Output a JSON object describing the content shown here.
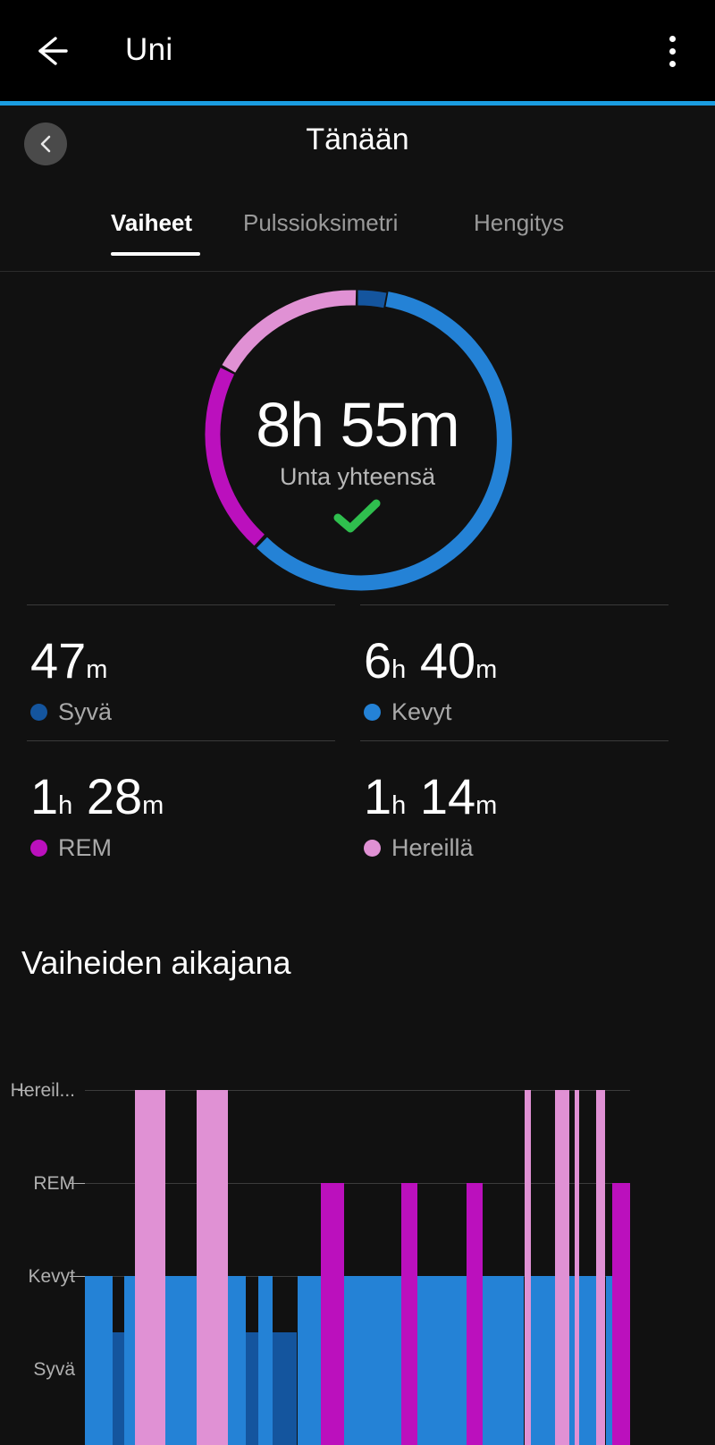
{
  "appbar": {
    "title": "Uni",
    "back_icon": "arrow-left-icon",
    "menu_icon": "overflow-menu-icon"
  },
  "date_nav": {
    "prev_icon": "chevron-left-icon",
    "label": "Tänään"
  },
  "tabs": [
    {
      "label": "Vaiheet",
      "active": true
    },
    {
      "label": "Pulssioksimetri",
      "active": false
    },
    {
      "label": "Hengitys",
      "active": false
    }
  ],
  "summary": {
    "total": "8h 55m",
    "caption": "Unta yhteensä",
    "goal_met_icon": "green-check-icon",
    "goal_met_color": "#2fbf4e"
  },
  "colors": {
    "deep": "#14559e",
    "light": "#2482d6",
    "rem": "#bb10bd",
    "awake": "#e091d4",
    "accent": "#1a9ce0",
    "background": "#111111",
    "appbar_background": "#000000"
  },
  "stats": [
    {
      "value": "47",
      "unit1": "m",
      "value2": "",
      "unit2": "",
      "label": "Syvä",
      "color": "#14559e"
    },
    {
      "value": "6",
      "unit1": "h",
      "value2": "40",
      "unit2": "m",
      "label": "Kevyt",
      "color": "#2482d6"
    },
    {
      "value": "1",
      "unit1": "h",
      "value2": "28",
      "unit2": "m",
      "label": "REM",
      "color": "#bb10bd"
    },
    {
      "value": "1",
      "unit1": "h",
      "value2": "14",
      "unit2": "m",
      "label": "Hereillä",
      "color": "#e091d4"
    }
  ],
  "timeline": {
    "title": "Vaiheiden aikajana",
    "y_labels": [
      "Hereil...",
      "REM",
      "Kevyt",
      "Syvä"
    ]
  },
  "chart_data": {
    "type": "bar",
    "title": "Vaiheiden aikajana",
    "xlabel": "",
    "ylabel": "",
    "categories": [
      "Syvä",
      "Kevyt",
      "REM",
      "Hereillä"
    ],
    "level_order": [
      "Syvä",
      "Kevyt",
      "REM",
      "Hereillä"
    ],
    "level_colors": {
      "Syvä": "#14559e",
      "Kevyt": "#2482d6",
      "REM": "#bb10bd",
      "Hereillä": "#e091d4"
    },
    "grid": true,
    "legend_position": "none",
    "note": "Hypnogram: each segment is a contiguous run of one sleep stage across the night; x is fractional position 0-1 across the plot width, values are stage levels.",
    "segments": [
      {
        "stage": "Kevyt",
        "x0": 0.0,
        "x1": 0.05
      },
      {
        "stage": "Syvä",
        "x0": 0.05,
        "x1": 0.072
      },
      {
        "stage": "Kevyt",
        "x0": 0.072,
        "x1": 0.092
      },
      {
        "stage": "Hereillä",
        "x0": 0.092,
        "x1": 0.148
      },
      {
        "stage": "Kevyt",
        "x0": 0.148,
        "x1": 0.205
      },
      {
        "stage": "Hereillä",
        "x0": 0.205,
        "x1": 0.262
      },
      {
        "stage": "Kevyt",
        "x0": 0.262,
        "x1": 0.295
      },
      {
        "stage": "Syvä",
        "x0": 0.295,
        "x1": 0.318
      },
      {
        "stage": "Kevyt",
        "x0": 0.318,
        "x1": 0.345
      },
      {
        "stage": "Syvä",
        "x0": 0.345,
        "x1": 0.39
      },
      {
        "stage": "Kevyt",
        "x0": 0.39,
        "x1": 0.432
      },
      {
        "stage": "REM",
        "x0": 0.432,
        "x1": 0.475
      },
      {
        "stage": "Kevyt",
        "x0": 0.475,
        "x1": 0.58
      },
      {
        "stage": "REM",
        "x0": 0.58,
        "x1": 0.61
      },
      {
        "stage": "Kevyt",
        "x0": 0.61,
        "x1": 0.7
      },
      {
        "stage": "REM",
        "x0": 0.7,
        "x1": 0.73
      },
      {
        "stage": "Kevyt",
        "x0": 0.73,
        "x1": 0.806
      },
      {
        "stage": "Hereillä",
        "x0": 0.806,
        "x1": 0.818
      },
      {
        "stage": "Kevyt",
        "x0": 0.818,
        "x1": 0.862
      },
      {
        "stage": "Hereillä",
        "x0": 0.862,
        "x1": 0.888
      },
      {
        "stage": "Kevyt",
        "x0": 0.888,
        "x1": 0.898
      },
      {
        "stage": "Hereillä",
        "x0": 0.898,
        "x1": 0.906
      },
      {
        "stage": "Kevyt",
        "x0": 0.906,
        "x1": 0.938
      },
      {
        "stage": "Hereillä",
        "x0": 0.938,
        "x1": 0.955
      },
      {
        "stage": "Kevyt",
        "x0": 0.955,
        "x1": 0.968
      },
      {
        "stage": "REM",
        "x0": 0.968,
        "x1": 1.0
      }
    ]
  }
}
